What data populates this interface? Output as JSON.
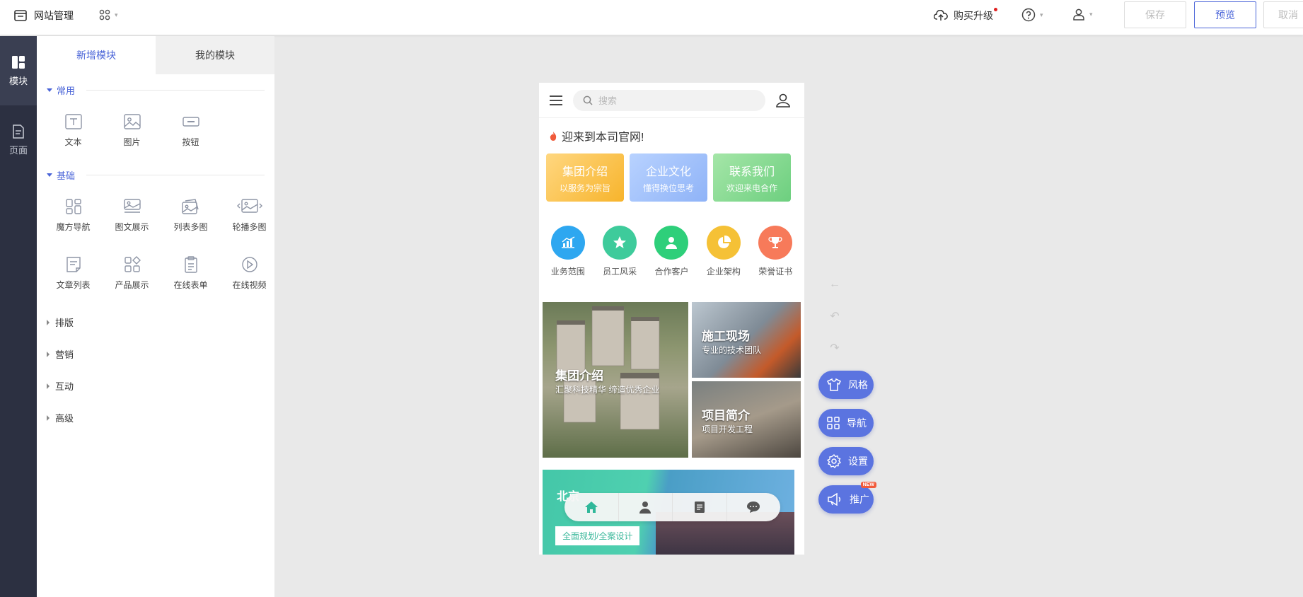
{
  "topbar": {
    "site_manage": "网站管理",
    "upgrade": "购买升级",
    "save": "保存",
    "preview": "预览",
    "cancel": "取消"
  },
  "rail": [
    {
      "label": "模块",
      "icon": "modules-icon",
      "active": true
    },
    {
      "label": "页面",
      "icon": "page-icon",
      "active": false
    }
  ],
  "panel": {
    "tabs": [
      "新增模块",
      "我的模块"
    ],
    "common_title": "常用",
    "common": [
      {
        "label": "文本",
        "icon": "text-icon"
      },
      {
        "label": "图片",
        "icon": "image-icon"
      },
      {
        "label": "按钮",
        "icon": "button-icon"
      }
    ],
    "basic_title": "基础",
    "basic": [
      {
        "label": "魔方导航",
        "icon": "cube-nav-icon"
      },
      {
        "label": "图文展示",
        "icon": "image-text-icon"
      },
      {
        "label": "列表多图",
        "icon": "list-images-icon"
      },
      {
        "label": "轮播多图",
        "icon": "carousel-icon"
      },
      {
        "label": "文章列表",
        "icon": "article-list-icon"
      },
      {
        "label": "产品展示",
        "icon": "product-icon"
      },
      {
        "label": "在线表单",
        "icon": "form-icon"
      },
      {
        "label": "在线视频",
        "icon": "video-icon"
      }
    ],
    "collapsed": [
      "排版",
      "营销",
      "互动",
      "高级"
    ]
  },
  "phone": {
    "search_placeholder": "搜索",
    "marquee": "迎来到本司官网!",
    "cards": [
      {
        "title": "集团介绍",
        "sub": "以服务为宗旨"
      },
      {
        "title": "企业文化",
        "sub": "懂得换位思考"
      },
      {
        "title": "联系我们",
        "sub": "欢迎来电合作"
      }
    ],
    "icons": [
      {
        "label": "业务范围",
        "color": "#2ea7f0",
        "icon": "chart-icon"
      },
      {
        "label": "员工风采",
        "color": "#3ecb9b",
        "icon": "star-icon"
      },
      {
        "label": "合作客户",
        "color": "#2ecf7a",
        "icon": "person-icon"
      },
      {
        "label": "企业架构",
        "color": "#f5c136",
        "icon": "pie-icon"
      },
      {
        "label": "荣誉证书",
        "color": "#f77a5a",
        "icon": "trophy-icon"
      }
    ],
    "mosaic": {
      "big_title": "集团介绍",
      "big_sub": "汇聚科技精华 缔造优秀企业",
      "top_title": "施工现场",
      "top_sub": "专业的技术团队",
      "bot_title": "项目简介",
      "bot_sub": "项目开发工程"
    },
    "banner": {
      "title": "北京",
      "tag": "全面规划/全案设计"
    }
  },
  "fabs": [
    {
      "label": "风格",
      "icon": "shirt-icon"
    },
    {
      "label": "导航",
      "icon": "grid-icon"
    },
    {
      "label": "设置",
      "icon": "gear-icon"
    },
    {
      "label": "推广",
      "icon": "megaphone-icon",
      "badge": "NEW"
    }
  ]
}
